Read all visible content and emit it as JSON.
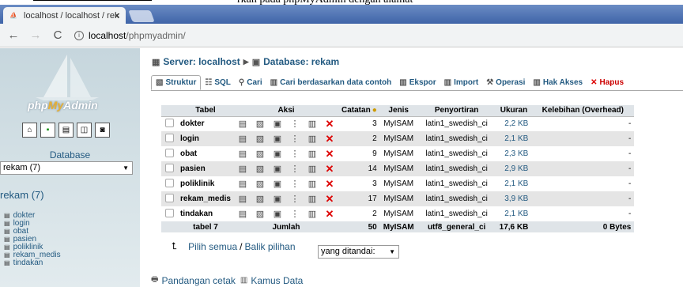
{
  "browser": {
    "top_strip_text": "rkan pada phpMyAdmin dengan alamat",
    "tab_title": "localhost / localhost / rek",
    "tab_close": "×",
    "url_host": "localhost",
    "url_path": "/phpmyadmin/"
  },
  "sidebar": {
    "logo_prefix": "php",
    "logo_highlight": "My",
    "logo_suffix": "Admin",
    "database_label": "Database",
    "database_select": "rekam (7)",
    "db_heading": "rekam (7)",
    "tables": [
      "dokter",
      "login",
      "obat",
      "pasien",
      "poliklinik",
      "rekam_medis",
      "tindakan"
    ]
  },
  "breadcrumb": {
    "server": "Server: localhost",
    "database": "Database: rekam"
  },
  "tabs": [
    "Struktur",
    "SQL",
    "Cari",
    "Cari berdasarkan data contoh",
    "Ekspor",
    "Import",
    "Operasi",
    "Hak Akses",
    "Hapus"
  ],
  "table": {
    "headers": [
      "Tabel",
      "Aksi",
      "Catatan",
      "Jenis",
      "Penyortiran",
      "Ukuran",
      "Kelebihan (Overhead)"
    ],
    "rows": [
      {
        "name": "dokter",
        "records": "3",
        "engine": "MyISAM",
        "collation": "latin1_swedish_ci",
        "size": "2,2 KB",
        "overhead": "-"
      },
      {
        "name": "login",
        "records": "2",
        "engine": "MyISAM",
        "collation": "latin1_swedish_ci",
        "size": "2,1 KB",
        "overhead": "-"
      },
      {
        "name": "obat",
        "records": "9",
        "engine": "MyISAM",
        "collation": "latin1_swedish_ci",
        "size": "2,3 KB",
        "overhead": "-"
      },
      {
        "name": "pasien",
        "records": "14",
        "engine": "MyISAM",
        "collation": "latin1_swedish_ci",
        "size": "2,9 KB",
        "overhead": "-"
      },
      {
        "name": "poliklinik",
        "records": "3",
        "engine": "MyISAM",
        "collation": "latin1_swedish_ci",
        "size": "2,1 KB",
        "overhead": "-"
      },
      {
        "name": "rekam_medis",
        "records": "17",
        "engine": "MyISAM",
        "collation": "latin1_swedish_ci",
        "size": "3,9 KB",
        "overhead": "-"
      },
      {
        "name": "tindakan",
        "records": "2",
        "engine": "MyISAM",
        "collation": "latin1_swedish_ci",
        "size": "2,1 KB",
        "overhead": "-"
      }
    ],
    "footer": {
      "tables": "tabel 7",
      "sum": "Jumlah",
      "records": "50",
      "engine": "MyISAM",
      "collation": "utf8_general_ci",
      "size": "17,6 KB",
      "overhead": "0 Bytes"
    }
  },
  "bulk": {
    "select_all": "Pilih semua",
    "separator": "/",
    "invert": "Balik pilihan",
    "with_selected": "yang ditandai:"
  },
  "footer_links": {
    "print": "Pandangan cetak",
    "dictionary": "Kamus Data"
  }
}
